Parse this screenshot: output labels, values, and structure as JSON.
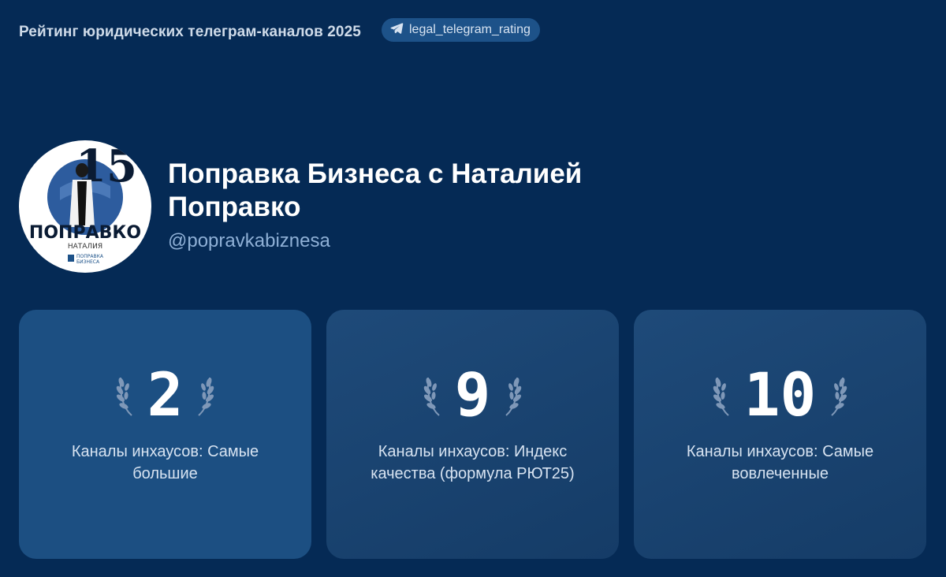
{
  "header": {
    "title": "Рейтинг юридических телеграм-каналов 2025",
    "tag": "legal_telegram_rating",
    "tag_icon": "telegram-send-icon"
  },
  "channel": {
    "title": "Поправка Бизнеса с Наталией Поправко",
    "handle": "@popravkabiznesa",
    "avatar": {
      "big_text": "ПОПРАВКО",
      "sub_text": "НАТАЛИЯ",
      "brand_line1": "ПОПРАВКА",
      "brand_line2": "БИЗНЕСА"
    }
  },
  "cards": [
    {
      "rank": "2",
      "label": "Каналы инхаусов: Самые большие",
      "icon": "laurel-icon"
    },
    {
      "rank": "9",
      "label": "Каналы инхаусов: Индекс качества (формула РЮТ25)",
      "icon": "laurel-icon"
    },
    {
      "rank": "10",
      "label": "Каналы инхаусов: Самые вовлеченные",
      "icon": "laurel-icon"
    }
  ],
  "colors": {
    "background": "#052a55",
    "card_primary": "#1c4f82",
    "card_secondary": "#1a4470",
    "accent_text": "#8fb0d6"
  }
}
